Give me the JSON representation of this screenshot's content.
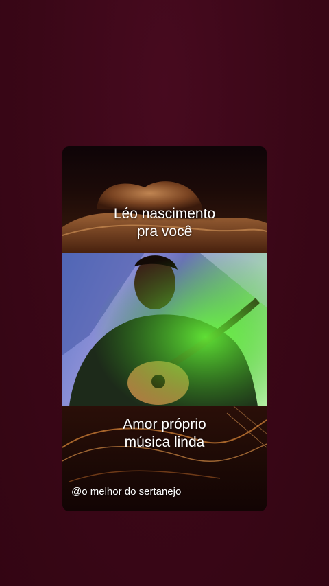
{
  "video": {
    "caption_top": [
      "Léo nascimento",
      "pra você"
    ],
    "caption_bottom": [
      "Amor próprio",
      "música linda"
    ],
    "watermark": "@o melhor do sertanejo"
  },
  "colors": {
    "background": "#3a0717",
    "caption_text": "#ffffff"
  },
  "icons": [
    "cowboy-hat-graphic",
    "guitarist-photo",
    "sparkle-swirl-graphic"
  ]
}
